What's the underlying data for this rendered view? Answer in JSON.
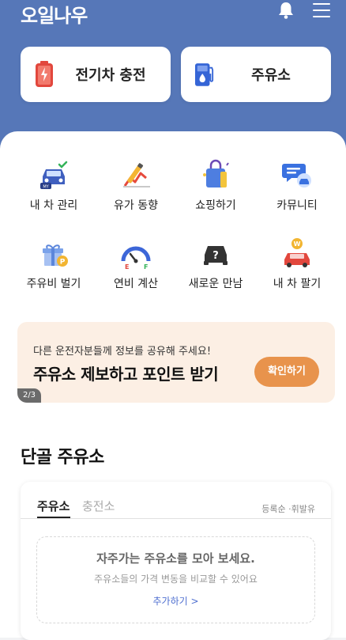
{
  "app": {
    "logo": "오일나우"
  },
  "header": {
    "bell_icon": "bell-icon",
    "menu_icon": "hamburger-menu-icon"
  },
  "top_cards": {
    "ev": {
      "label": "전기차 충전",
      "icon": "battery-icon"
    },
    "gas": {
      "label": "주유소",
      "icon": "fuel-pump-icon"
    }
  },
  "menu": {
    "row1": [
      {
        "label": "내 차 관리",
        "icon": "my-car-icon"
      },
      {
        "label": "유가 동향",
        "icon": "price-trend-icon"
      },
      {
        "label": "쇼핑하기",
        "icon": "shopping-bag-icon"
      },
      {
        "label": "카뮤니티",
        "icon": "community-chat-icon"
      }
    ],
    "row2": [
      {
        "label": "주유비 벌기",
        "icon": "gift-icon"
      },
      {
        "label": "연비 계산",
        "icon": "fuel-gauge-icon"
      },
      {
        "label": "새로운 만남",
        "icon": "mystery-car-icon"
      },
      {
        "label": "내 차 팔기",
        "icon": "sell-car-icon"
      }
    ]
  },
  "banner": {
    "subtitle": "다른 운전자분들께 정보를 공유해 주세요!",
    "title": "주유소 제보하고 포인트 받기",
    "button": "확인하기",
    "page_indicator": "2/3"
  },
  "favorites": {
    "section_title": "단골 주유소",
    "tabs": [
      "주유소",
      "충전소"
    ],
    "active_tab": "주유소",
    "sort": "등록순 ·휘발유",
    "empty_title": "자주가는 주유소를 모아 보세요.",
    "empty_desc": "주유소들의 가격 변동을 비교할 수 있어요",
    "add_link": "추가하기 >"
  },
  "colors": {
    "brand_blue": "#5677b8",
    "banner_bg": "#fcefe4",
    "cta_orange": "#e8934c",
    "link_blue": "#4f6fd0"
  }
}
